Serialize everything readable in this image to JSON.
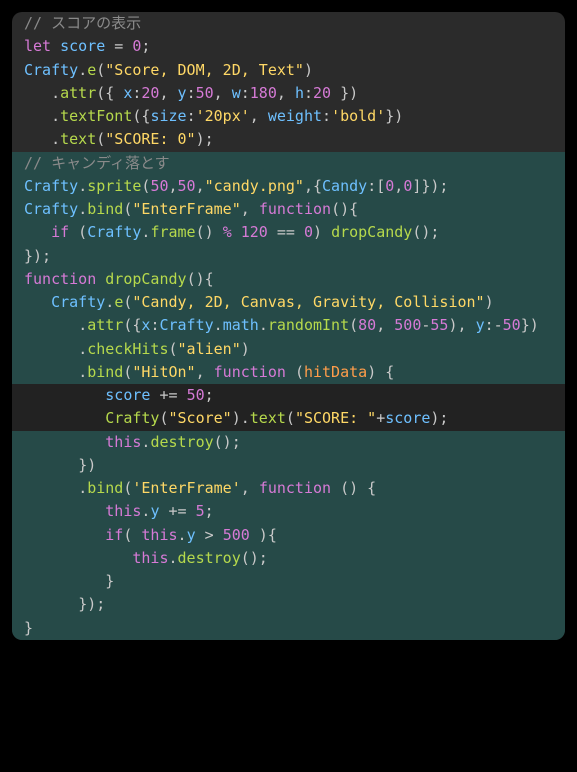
{
  "code": {
    "l1_comment": "// スコアの表示",
    "l2_let": "let",
    "l2_var": "score",
    "l2_eq": " = ",
    "l2_zero": "0",
    "l2_semi": ";",
    "l3_crafty": "Crafty",
    "l3_dot": ".",
    "l3_e": "e",
    "l3_open": "(",
    "l3_str": "\"Score, DOM, 2D, Text\"",
    "l3_close": ")",
    "l4_ind": "   ",
    "l4_dot": ".",
    "l4_attr": "attr",
    "l4_open": "({ ",
    "l4_x": "x",
    "l4_colon": ":",
    "l4_20": "20",
    "l4_c1": ", ",
    "l4_y": "y",
    "l4_50": "50",
    "l4_c2": ", ",
    "l4_w": "w",
    "l4_180": "180",
    "l4_c3": ", ",
    "l4_h": "h",
    "l4_h20": "20",
    "l4_close": " })",
    "l5_ind": "   ",
    "l5_dot": ".",
    "l5_tf": "textFont",
    "l5_open": "({",
    "l5_size": "size",
    "l5_colon": ":",
    "l5_str1": "'20px'",
    "l5_c": ", ",
    "l5_weight": "weight",
    "l5_str2": "'bold'",
    "l5_close": "})",
    "l6_ind": "   ",
    "l6_dot": ".",
    "l6_text": "text",
    "l6_open": "(",
    "l6_str": "\"SCORE: 0\"",
    "l6_close": ");",
    "l7_comment": "// キャンディ落とす",
    "l8_crafty": "Crafty",
    "l8_dot": ".",
    "l8_sprite": "sprite",
    "l8_open": "(",
    "l8_50a": "50",
    "l8_c1": ",",
    "l8_50b": "50",
    "l8_c2": ",",
    "l8_str": "\"candy.png\"",
    "l8_c3": ",{",
    "l8_candy": "Candy",
    "l8_colon": ":[",
    "l8_0a": "0",
    "l8_c4": ",",
    "l8_0b": "0",
    "l8_close": "]});",
    "l9_crafty": "Crafty",
    "l9_dot": ".",
    "l9_bind": "bind",
    "l9_open": "(",
    "l9_str": "\"EnterFrame\"",
    "l9_c": ", ",
    "l9_func": "function",
    "l9_parens": "(){",
    "l10_ind": "   ",
    "l10_if": "if",
    "l10_open": " (",
    "l10_crafty": "Crafty",
    "l10_dot": ".",
    "l10_frame": "frame",
    "l10_parens": "() ",
    "l10_mod": "%",
    "l10_sp": " ",
    "l10_120": "120",
    "l10_eq": " == ",
    "l10_0": "0",
    "l10_close": ") ",
    "l10_drop": "dropCandy",
    "l10_call": "();",
    "l11": "});",
    "l12_func": "function",
    "l12_sp": " ",
    "l12_name": "dropCandy",
    "l12_parens": "(){",
    "l13_ind": "   ",
    "l13_crafty": "Crafty",
    "l13_dot": ".",
    "l13_e": "e",
    "l13_open": "(",
    "l13_str": "\"Candy, 2D, Canvas, Gravity, Collision\"",
    "l13_close": ")",
    "l14_ind": "      ",
    "l14_dot": ".",
    "l14_attr": "attr",
    "l14_open": "({",
    "l14_x": "x",
    "l14_colon": ":",
    "l14_crafty": "Crafty",
    "l14_d1": ".",
    "l14_math": "math",
    "l14_d2": ".",
    "l14_rand": "randomInt",
    "l14_p1": "(",
    "l14_80": "80",
    "l14_c1": ", ",
    "l14_500": "500",
    "l14_minus": "-",
    "l14_55": "55",
    "l14_p2": "), ",
    "l14_y": "y",
    "l14_colon2": ":",
    "l14_neg": "-",
    "l14_50": "50",
    "l14_close": "})",
    "l15_ind": "      ",
    "l15_dot": ".",
    "l15_check": "checkHits",
    "l15_open": "(",
    "l15_str": "\"alien\"",
    "l15_close": ")",
    "l16_ind": "      ",
    "l16_dot": ".",
    "l16_bind": "bind",
    "l16_open": "(",
    "l16_str": "\"HitOn\"",
    "l16_c": ", ",
    "l16_func": "function",
    "l16_sp": " ",
    "l16_p1": "(",
    "l16_param": "hitData",
    "l16_p2": ") {",
    "l17_ind": "         ",
    "l17_score": "score",
    "l17_pluseq": " += ",
    "l17_50": "50",
    "l17_semi": ";",
    "l18_ind": "         ",
    "l18_crafty": "Crafty",
    "l18_open": "(",
    "l18_str1": "\"Score\"",
    "l18_close": ").",
    "l18_text": "text",
    "l18_p1": "(",
    "l18_str2": "\"SCORE: \"",
    "l18_plus": "+",
    "l18_score": "score",
    "l18_p2": ");",
    "l19_ind": "         ",
    "l19_this": "this",
    "l19_dot": ".",
    "l19_destroy": "destroy",
    "l19_call": "();",
    "l20_ind": "      ",
    "l20": "})",
    "l21_ind": "      ",
    "l21_dot": ".",
    "l21_bind": "bind",
    "l21_open": "(",
    "l21_str": "'EnterFrame'",
    "l21_c": ", ",
    "l21_func": "function",
    "l21_sp": " ",
    "l21_parens": "() {",
    "l22_ind": "         ",
    "l22_this": "this",
    "l22_dot": ".",
    "l22_y": "y",
    "l22_pluseq": " += ",
    "l22_5": "5",
    "l22_semi": ";",
    "l23_ind": "         ",
    "l23_if": "if",
    "l23_open": "( ",
    "l23_this": "this",
    "l23_dot": ".",
    "l23_y": "y",
    "l23_gt": " > ",
    "l23_500": "500",
    "l23_close": " ){",
    "l24_ind": "            ",
    "l24_this": "this",
    "l24_dot": ".",
    "l24_destroy": "destroy",
    "l24_call": "();",
    "l25_ind": "         ",
    "l25": "}",
    "l26_ind": "      ",
    "l26": "});",
    "l27": "}"
  },
  "colors": {
    "comment": "#8a8a8a",
    "keyword": "#d67ad6",
    "variable": "#6ec0ff",
    "function": "#b6d94c",
    "string": "#ffd866",
    "param": "#ff9d4a",
    "punct": "#c9c9c9",
    "bg": "#2b2b2b",
    "hlTeal": "#264a48",
    "hlDark": "#222222"
  }
}
